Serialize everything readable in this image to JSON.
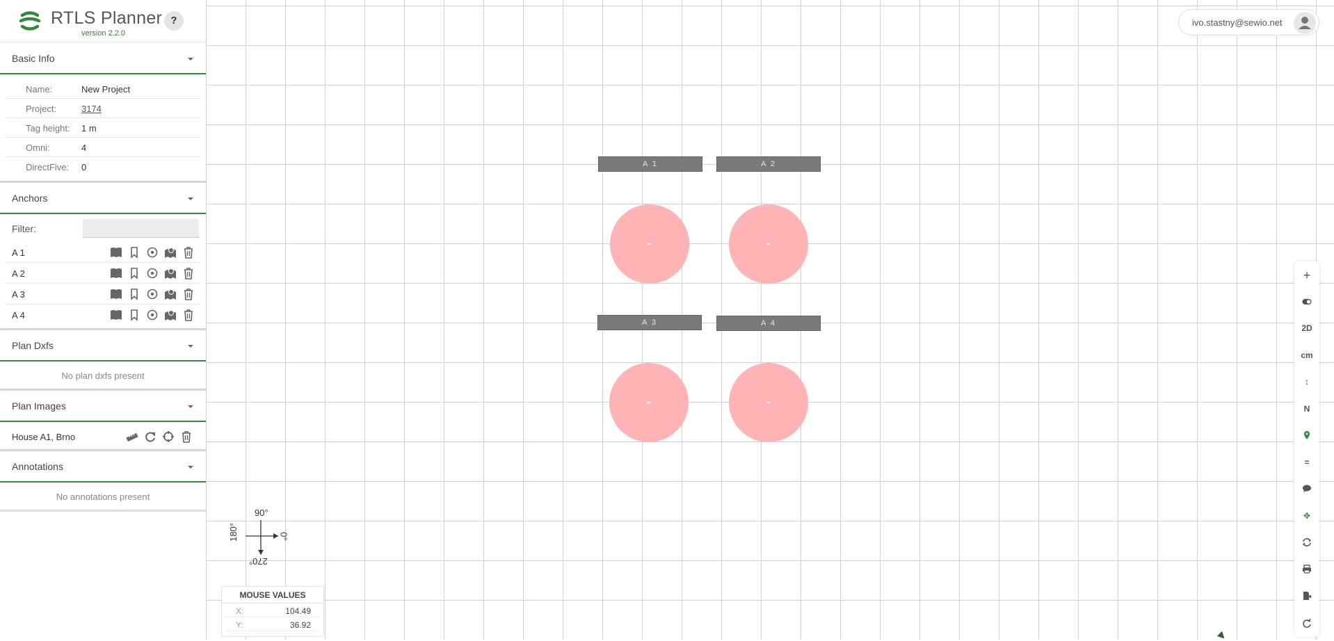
{
  "app": {
    "title": "RTLS Planner",
    "version": "version 2.2.0",
    "help_label": "?",
    "brand_color": "#2e8b3a",
    "logo_icon": "rtls-logo-icon"
  },
  "sidebar": {
    "basic_info": {
      "header": "Basic Info",
      "rows": [
        {
          "key": "Name:",
          "value": "New Project"
        },
        {
          "key": "Project:",
          "value": "3174"
        },
        {
          "key": "Tag height:",
          "value": "1 m"
        },
        {
          "key": "Omni:",
          "value": "4"
        },
        {
          "key": "DirectFive:",
          "value": "0"
        }
      ]
    },
    "anchors": {
      "header": "Anchors",
      "filter_label": "Filter:",
      "filter_value": "",
      "items": [
        {
          "name": "A 1"
        },
        {
          "name": "A 2"
        },
        {
          "name": "A 3"
        },
        {
          "name": "A 4"
        }
      ],
      "row_icons": [
        "book-icon",
        "bookmark-icon",
        "target-icon",
        "map-pin-icon",
        "trash-icon"
      ]
    },
    "plan_dxfs": {
      "header": "Plan Dxfs",
      "empty": "No plan dxfs present"
    },
    "plan_images": {
      "header": "Plan Images",
      "items": [
        {
          "name": "House A1, Brno"
        }
      ],
      "row_icons": [
        "ruler-icon",
        "refresh-icon",
        "crosshair-icon",
        "trash-icon"
      ]
    },
    "annotations": {
      "header": "Annotations",
      "empty": "No annotations present"
    }
  },
  "canvas": {
    "anchors": [
      {
        "label": "A 1"
      },
      {
        "label": "A 2"
      },
      {
        "label": "A 3"
      },
      {
        "label": "A 4"
      }
    ],
    "coverage_color": "#ffb3b5",
    "label_color": "#7a7a7a",
    "user_email": "ivo.stastny@sewio.net",
    "compass": {
      "top": "90°",
      "left": "180°",
      "right": "0°",
      "bottom": "270°"
    },
    "mouse_values": {
      "header": "MOUSE VALUES",
      "x_label": "X:",
      "x_value": "104.49",
      "y_label": "Y:",
      "y_value": "36.92"
    },
    "toolbar": [
      {
        "label": "+",
        "icon": "zoom-in-icon"
      },
      {
        "label": "",
        "icon": "toggle-icon"
      },
      {
        "label": "2D",
        "icon": "view-2d"
      },
      {
        "label": "cm",
        "icon": "units"
      },
      {
        "label": "↕",
        "icon": "height-icon"
      },
      {
        "label": "N",
        "icon": "north-icon"
      },
      {
        "label": "",
        "icon": "location-pin-icon"
      },
      {
        "label": "=",
        "icon": "align-icon"
      },
      {
        "label": "",
        "icon": "comment-icon"
      },
      {
        "label": "✥",
        "icon": "move-icon"
      },
      {
        "label": "",
        "icon": "sync-icon"
      },
      {
        "label": "",
        "icon": "print-icon"
      },
      {
        "label": "",
        "icon": "export-icon"
      },
      {
        "label": "",
        "icon": "redo-icon"
      }
    ]
  }
}
